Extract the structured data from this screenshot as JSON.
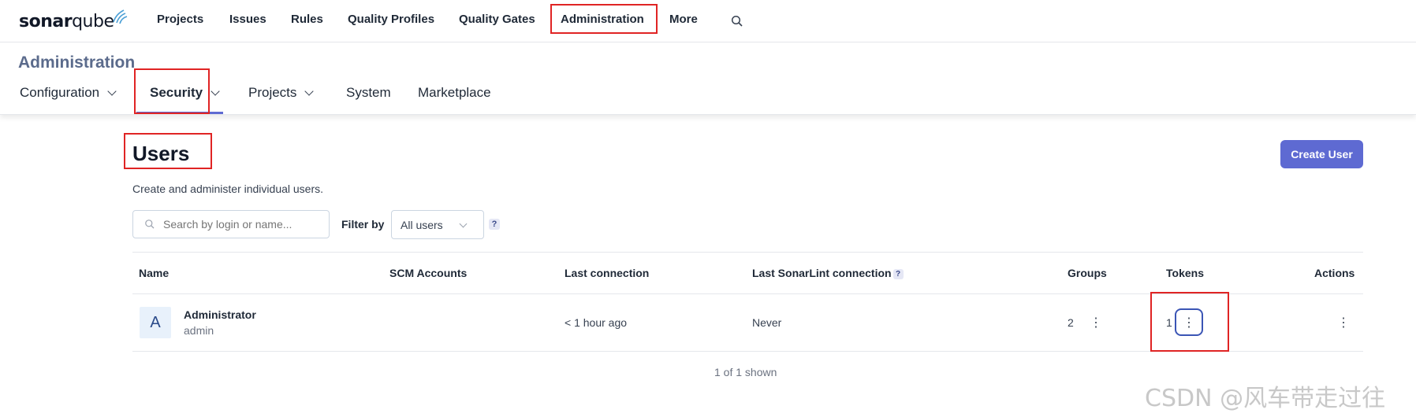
{
  "brand": {
    "logo_text_bold": "sonar",
    "logo_text_light": "qube",
    "logo_icon": "sonarqube-waves-icon"
  },
  "topnav": {
    "items": [
      {
        "label": "Projects"
      },
      {
        "label": "Issues"
      },
      {
        "label": "Rules"
      },
      {
        "label": "Quality Profiles"
      },
      {
        "label": "Quality Gates"
      },
      {
        "label": "Administration"
      },
      {
        "label": "More"
      }
    ],
    "search_icon": "search-icon"
  },
  "admin": {
    "title": "Administration",
    "subnav": [
      {
        "label": "Configuration",
        "has_dropdown": true
      },
      {
        "label": "Security",
        "has_dropdown": true,
        "active": true
      },
      {
        "label": "Projects",
        "has_dropdown": true
      },
      {
        "label": "System",
        "has_dropdown": false
      },
      {
        "label": "Marketplace",
        "has_dropdown": false
      }
    ]
  },
  "users": {
    "title": "Users",
    "subtitle": "Create and administer individual users.",
    "create_button": "Create User",
    "search_placeholder": "Search by login or name...",
    "filter_label": "Filter by",
    "filter_value": "All users",
    "help_mark": "?",
    "columns": {
      "name": "Name",
      "scm": "SCM Accounts",
      "last_connection": "Last connection",
      "last_sonarlint": "Last SonarLint connection",
      "groups": "Groups",
      "tokens": "Tokens",
      "actions": "Actions"
    },
    "rows": [
      {
        "avatar_letter": "A",
        "name": "Administrator",
        "login": "admin",
        "scm": "",
        "last_connection": "< 1 hour ago",
        "last_sonarlint": "Never",
        "groups": "2",
        "tokens": "1"
      }
    ],
    "shown_text": "1 of 1 shown"
  },
  "kebab_glyph": "⋮",
  "watermark": "CSDN @风车带走过往",
  "colors": {
    "accent": "#5e6ad2",
    "highlight": "#e02424",
    "admin_title": "#5b6b8c"
  }
}
